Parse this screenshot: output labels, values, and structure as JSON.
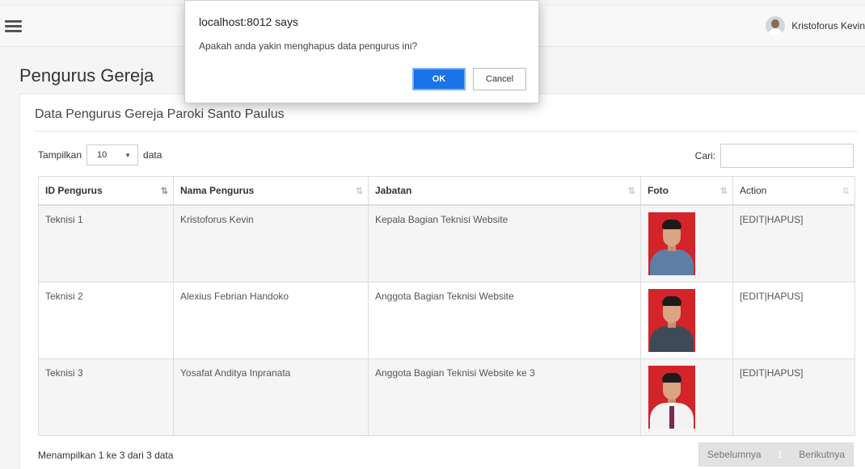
{
  "header": {
    "user_name": "Kristoforus Kevin"
  },
  "page": {
    "title": "Pengurus Gereja"
  },
  "panel": {
    "heading": "Data Pengurus Gereja Paroki Santo Paulus",
    "length_label_prefix": "Tampilkan",
    "length_value": "10",
    "length_label_suffix": "data",
    "search_label": "Cari:",
    "search_value": ""
  },
  "table": {
    "columns": [
      "ID Pengurus",
      "Nama Pengurus",
      "Jabatan",
      "Foto",
      "Action"
    ],
    "rows": [
      {
        "id": "Teknisi 1",
        "nama": "Kristoforus Kevin",
        "jabatan": "Kepala Bagian Teknisi Website",
        "action_edit": "[EDIT",
        "action_sep": "|",
        "action_delete": "HAPUS]",
        "photo_bg": "#d3242a",
        "photo_shirt": "#5d7fa6"
      },
      {
        "id": "Teknisi 2",
        "nama": "Alexius Febrian Handoko",
        "jabatan": "Anggota Bagian Teknisi Website",
        "action_edit": "[EDIT",
        "action_sep": "|",
        "action_delete": "HAPUS]",
        "photo_bg": "#d3242a",
        "photo_shirt": "#3e4a57"
      },
      {
        "id": "Teknisi 3",
        "nama": "Yosafat Anditya Inpranata",
        "jabatan": "Anggota Bagian Teknisi Website ke 3",
        "action_edit": "[EDIT",
        "action_sep": "|",
        "action_delete": "HAPUS]",
        "photo_bg": "#d3242a",
        "photo_shirt": "#f3f3f3"
      }
    ],
    "info": "Menampilkan 1 ke 3 dari 3 data"
  },
  "pagination": {
    "prev": "Sebelumnya",
    "current": "1",
    "next": "Berikutnya"
  },
  "dialog": {
    "title": "localhost:8012 says",
    "message": "Apakah anda yakin menghapus data pengurus ini?",
    "ok": "OK",
    "cancel": "Cancel"
  },
  "colors": {
    "ok_button": "#1a73e8"
  }
}
